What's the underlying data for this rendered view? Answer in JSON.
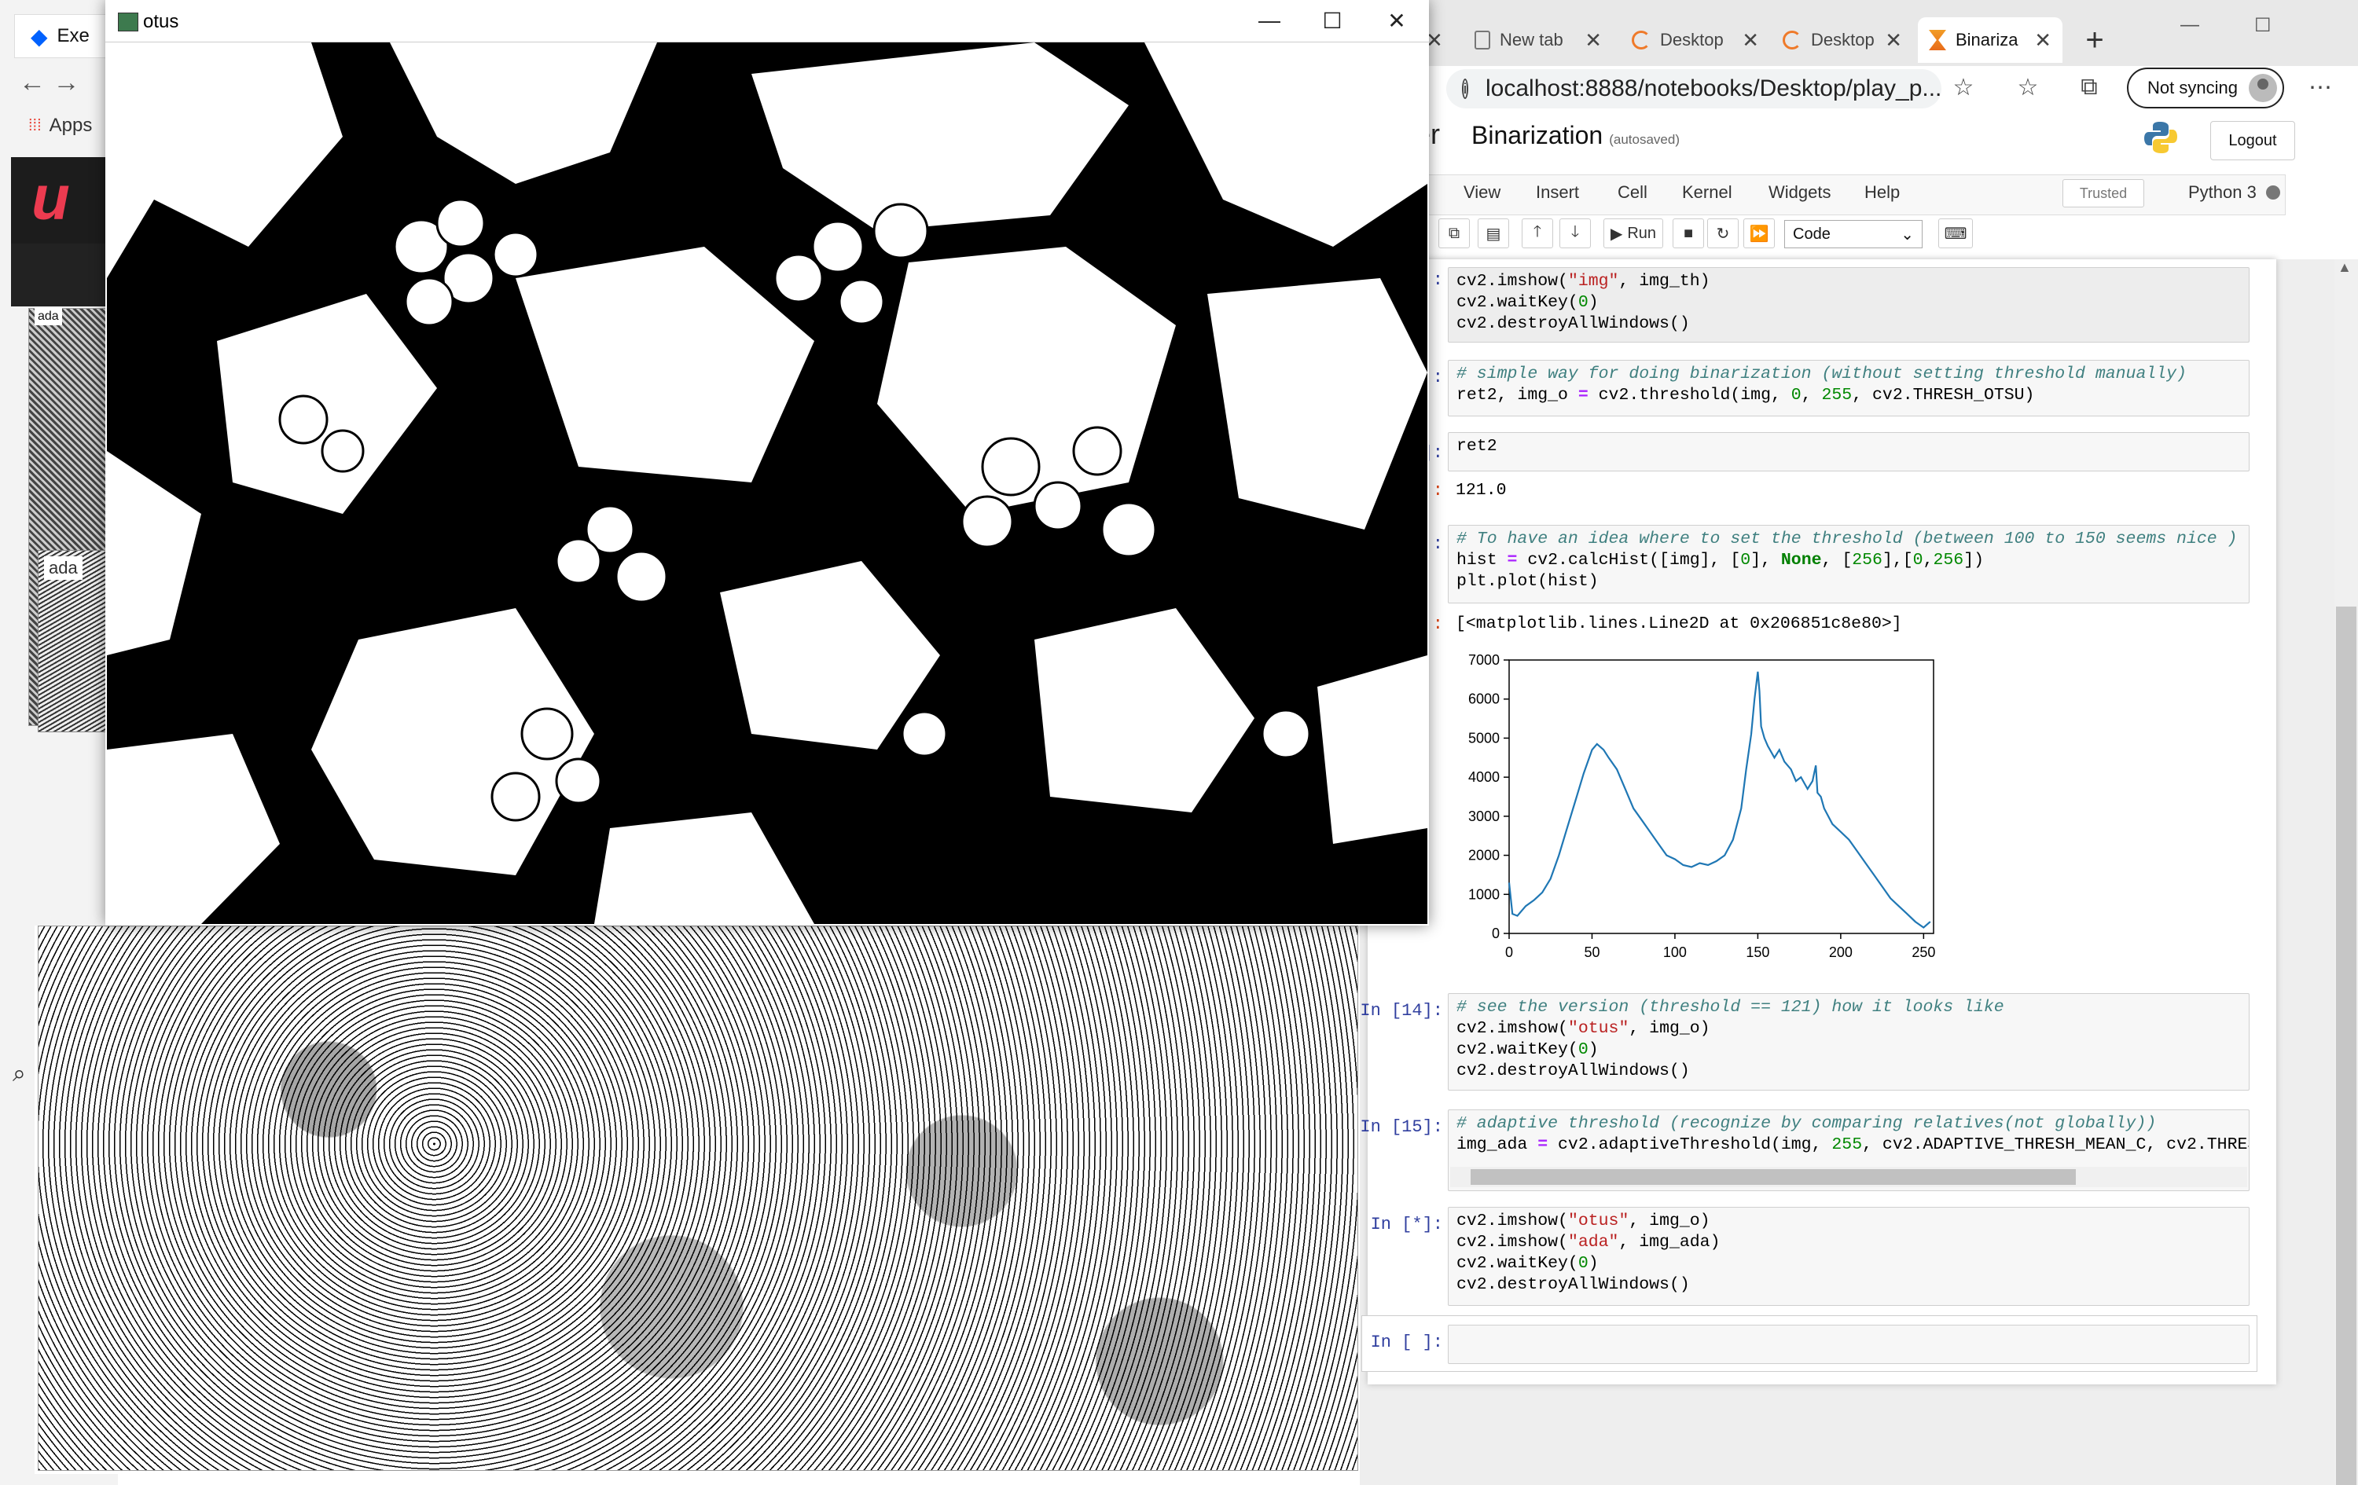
{
  "background_browser": {
    "dropbox_tab_label": "Exe",
    "apps_label": "Apps",
    "thumb_label": "ada",
    "thumb2_label": "ada"
  },
  "browser": {
    "tabs": [
      {
        "label": "New tab",
        "icon": "page-icon"
      },
      {
        "label": "Desktop",
        "icon": "jupyter-icon"
      },
      {
        "label": "Desktop",
        "icon": "jupyter-icon"
      },
      {
        "label": "Binariza",
        "icon": "hourglass-icon",
        "active": true
      }
    ],
    "address": "localhost:8888/notebooks/Desktop/play_p...",
    "not_syncing_label": "Not syncing"
  },
  "jupyter": {
    "brand_fragment": "er",
    "notebook_title": "Binarization",
    "autosave_status": "(autosaved)",
    "logout_label": "Logout",
    "menu": [
      "View",
      "Insert",
      "Cell",
      "Kernel",
      "Widgets",
      "Help"
    ],
    "trusted_label": "Trusted",
    "kernel_label": "Python 3",
    "toolbar": {
      "run_label": "Run",
      "cell_type": "Code"
    },
    "cells": {
      "c1_prompt": ":",
      "c2_prompt": ":",
      "c3_prompt": "]:",
      "c3_out_prompt": ":",
      "c3_output": "121.0",
      "c4_prompt": ":",
      "c4_out_prompt": ":",
      "c4_output": "[<matplotlib.lines.Line2D at 0x206851c8e80>]",
      "c5_prompt": "In [14]:",
      "c6_prompt": "In [15]:",
      "c7_prompt": "In [*]:",
      "c8_prompt": "In [ ]:"
    }
  },
  "chart_data": {
    "type": "line",
    "title": "",
    "xlabel": "",
    "ylabel": "",
    "xlim": [
      0,
      256
    ],
    "ylim": [
      0,
      7000
    ],
    "xticks": [
      0,
      50,
      100,
      150,
      200,
      250
    ],
    "yticks": [
      0,
      1000,
      2000,
      3000,
      4000,
      5000,
      6000,
      7000
    ],
    "color": "#1f77b4",
    "series": [
      {
        "x": [
          0,
          2,
          5,
          10,
          15,
          20,
          25,
          30,
          35,
          40,
          45,
          50,
          53,
          57,
          60,
          65,
          70,
          75,
          80,
          85,
          90,
          95,
          100,
          105,
          110,
          115,
          120,
          125,
          130,
          135,
          140,
          143,
          146,
          148,
          150,
          151,
          152,
          154,
          156,
          160,
          163,
          166,
          170,
          173,
          176,
          180,
          183,
          185,
          186,
          188,
          190,
          195,
          200,
          205,
          210,
          215,
          220,
          225,
          230,
          235,
          240,
          245,
          250,
          254
        ],
        "y": [
          1300,
          500,
          450,
          700,
          850,
          1050,
          1400,
          2000,
          2700,
          3400,
          4100,
          4700,
          4850,
          4700,
          4500,
          4200,
          3700,
          3200,
          2900,
          2600,
          2300,
          2000,
          1900,
          1750,
          1700,
          1800,
          1750,
          1850,
          2000,
          2400,
          3200,
          4200,
          5100,
          6000,
          6700,
          6200,
          5300,
          5000,
          4800,
          4500,
          4700,
          4400,
          4200,
          3900,
          4000,
          3700,
          3900,
          4300,
          3600,
          3500,
          3200,
          2800,
          2600,
          2400,
          2100,
          1800,
          1500,
          1200,
          900,
          700,
          500,
          300,
          150,
          300
        ]
      }
    ]
  },
  "windows": {
    "otus_title": "otus"
  },
  "colors": {
    "jupyter_in": "#303f9f",
    "jupyter_out": "#d84315",
    "comment": "#408080",
    "string": "#ba2121",
    "number": "#008800",
    "plot_line": "#1f77b4"
  }
}
